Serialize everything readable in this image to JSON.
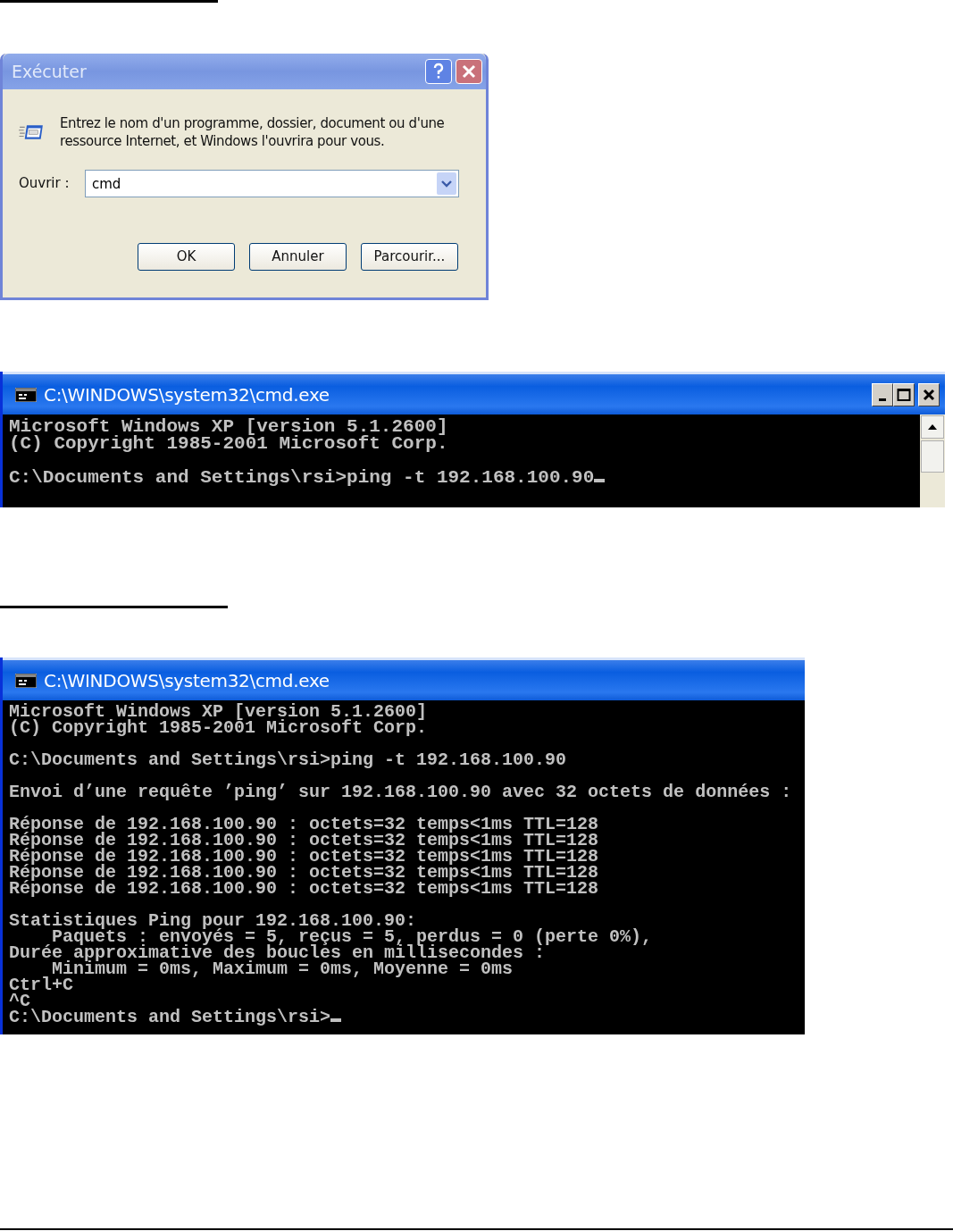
{
  "run_dialog": {
    "title": "Exécuter",
    "message": "Entrez le nom d'un programme, dossier, document ou d'une ressource Internet, et Windows l'ouvrira pour vous.",
    "open_label": "Ouvrir :",
    "input_value": "cmd",
    "buttons": [
      "OK",
      "Annuler",
      "Parcourir..."
    ]
  },
  "consoles": [
    {
      "title": "C:\\WINDOWS\\system32\\cmd.exe",
      "has_window_buttons": true,
      "has_scrollbar": true,
      "cursor": true,
      "blocks": [
        [
          "Microsoft Windows XP [version 5.1.2600]",
          "(C) Copyright 1985-2001 Microsoft Corp."
        ],
        [
          "C:\\Documents and Settings\\rsi>ping -t 192.168.100.90"
        ]
      ]
    },
    {
      "title": "C:\\WINDOWS\\system32\\cmd.exe",
      "has_window_buttons": false,
      "has_scrollbar": false,
      "cursor": true,
      "blocks": [
        [
          "Microsoft Windows XP [version 5.1.2600]",
          "(C) Copyright 1985-2001 Microsoft Corp."
        ],
        [
          "C:\\Documents and Settings\\rsi>ping -t 192.168.100.90"
        ],
        [
          "Envoi d’une requête ’ping’ sur 192.168.100.90 avec 32 octets de données :"
        ],
        [
          "Réponse de 192.168.100.90 : octets=32 temps<1ms TTL=128",
          "Réponse de 192.168.100.90 : octets=32 temps<1ms TTL=128",
          "Réponse de 192.168.100.90 : octets=32 temps<1ms TTL=128",
          "Réponse de 192.168.100.90 : octets=32 temps<1ms TTL=128",
          "Réponse de 192.168.100.90 : octets=32 temps<1ms TTL=128"
        ],
        [
          "Statistiques Ping pour 192.168.100.90:",
          "    Paquets : envoyés = 5, reçus = 5, perdus = 0 (perte 0%),",
          "Durée approximative des boucles en millisecondes :",
          "    Minimum = 0ms, Maximum = 0ms, Moyenne = 0ms",
          "Ctrl+C",
          "^C",
          "C:\\Documents and Settings\\rsi>"
        ]
      ]
    }
  ]
}
